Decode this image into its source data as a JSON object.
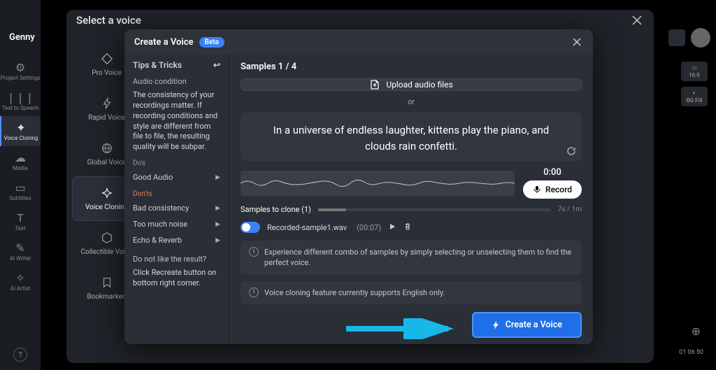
{
  "app": {
    "logo": "Genny"
  },
  "sidebar": {
    "items": [
      {
        "label": "Project Settings",
        "icon": "settings"
      },
      {
        "label": "Text to Speech",
        "icon": "tts"
      },
      {
        "label": "Voice Cloning",
        "icon": "clone",
        "active": true
      },
      {
        "label": "Media",
        "icon": "media"
      },
      {
        "label": "Subtitles",
        "icon": "subtitles"
      },
      {
        "label": "Text",
        "icon": "text"
      },
      {
        "label": "AI Writer",
        "icon": "pen"
      },
      {
        "label": "AI Artist",
        "icon": "brush"
      }
    ]
  },
  "right_chips": [
    {
      "label": "16:9"
    },
    {
      "label": "BG Fill"
    }
  ],
  "outer_modal": {
    "title": "Select a voice",
    "voice_items": [
      {
        "label": "Pro Voice"
      },
      {
        "label": "Rapid Voice"
      },
      {
        "label": "Global Voice"
      },
      {
        "label": "Voice Cloning",
        "active": true
      },
      {
        "label": "Collectible Voice"
      },
      {
        "label": "Bookmarked"
      }
    ]
  },
  "inner": {
    "title": "Create a Voice",
    "beta": "Beta",
    "tips": {
      "header": "Tips & Tricks",
      "collapse_icon": "↩",
      "audio_condition": "Audio condition",
      "para": "The consistency of your recordings matter. If recording conditions and style are different from file to file, the resulting quality will be subpar.",
      "dos_label": "Do's",
      "dos": [
        {
          "label": "Good Audio"
        }
      ],
      "donts_label": "Don'ts",
      "donts": [
        {
          "label": "Bad consistency"
        },
        {
          "label": "Too much noise"
        },
        {
          "label": "Echo & Reverb"
        }
      ],
      "dislike_q": "Do not like the result?",
      "dislike_a": "Click Recreate button on bottom right corner."
    },
    "samples_title": "Samples 1 / 4",
    "upload_label": "Upload audio files",
    "or": "or",
    "script": "In a universe of endless laughter, kittens play the piano, and clouds rain confetti.",
    "timer": "0:00",
    "record": "Record",
    "clone_label": "Samples to clone (1)",
    "clone_time": "7s / 1m",
    "sample": {
      "name": "Recorded-sample1.wav",
      "duration": "(00:07)"
    },
    "info1": "Experience different combo of samples by simply selecting or unselecting them to find the perfect voice.",
    "info2": "Voice cloning feature currently supports English only.",
    "create": "Create a Voice"
  },
  "bottom_time": "01 06 50"
}
